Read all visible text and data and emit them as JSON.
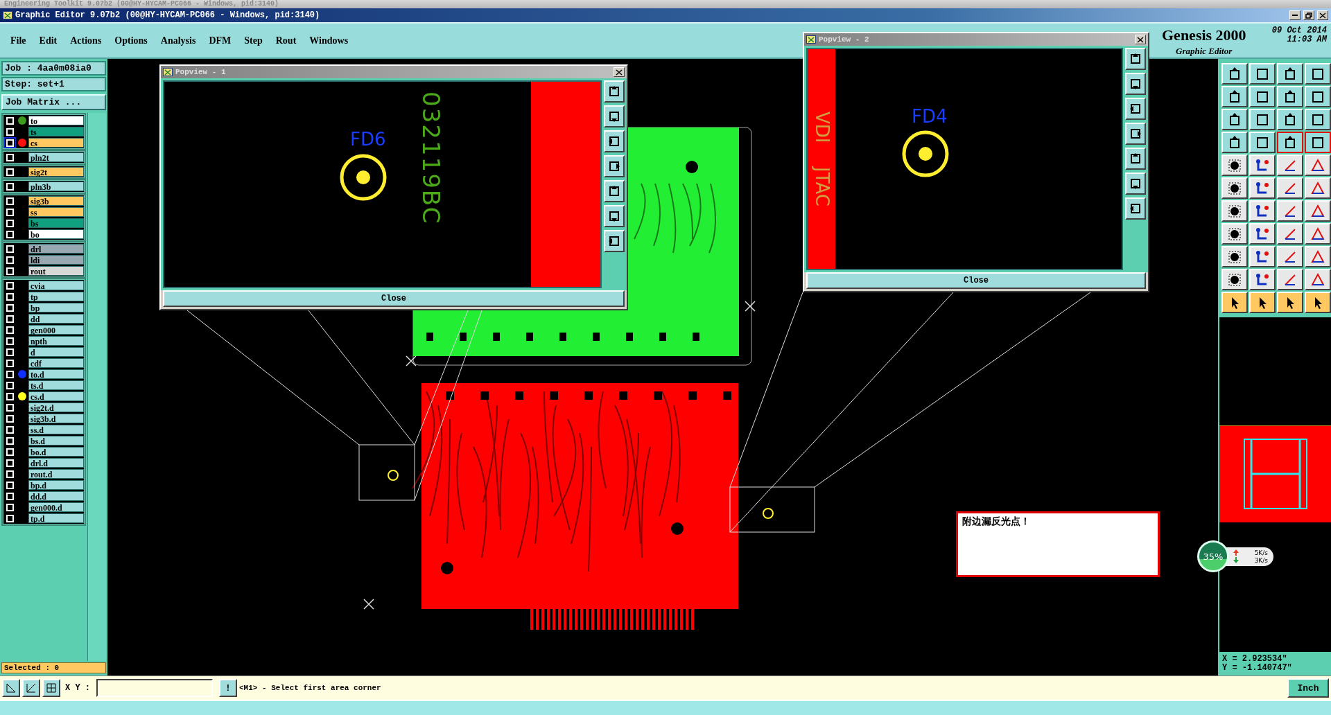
{
  "background_window": {
    "title": "Engineering Toolkit 9.07b2 (00@HY-HYCAM-PC066 - Windows, pid:3140)"
  },
  "window": {
    "title": "Graphic Editor 9.07b2 (00@HY-HYCAM-PC066 - Windows, pid:3140)"
  },
  "menu": [
    "File",
    "Edit",
    "Actions",
    "Options",
    "Analysis",
    "DFM",
    "Step",
    "Rout",
    "Windows"
  ],
  "brand": {
    "name": "Genesis 2000",
    "subtitle": "Graphic Editor",
    "date": "09 Oct 2014",
    "time": "11:03 AM"
  },
  "job": "Job : 4aa0m08ia0",
  "step": "Step: set+1",
  "job_matrix_button": "Job Matrix ...",
  "layer_groups": [
    {
      "layers": [
        {
          "name": "to",
          "color": "#ffffff",
          "marker": {
            "color": "#3c9a1e"
          },
          "selected": false
        },
        {
          "name": "ts",
          "color": "#10a080",
          "selected": false
        },
        {
          "name": "cs",
          "color": "#ffc860",
          "marker": {
            "color": "#ff1010"
          },
          "selected": true
        }
      ]
    },
    {
      "layers": [
        {
          "name": "pln2t",
          "color": "#a0dcdc",
          "selected": false
        }
      ]
    },
    {
      "layers": [
        {
          "name": "sig2t",
          "color": "#ffc860",
          "selected": false
        }
      ]
    },
    {
      "layers": [
        {
          "name": "pln3b",
          "color": "#a0dcdc",
          "selected": false
        }
      ]
    },
    {
      "layers": [
        {
          "name": "sig3b",
          "color": "#ffc860",
          "selected": false
        },
        {
          "name": "ss",
          "color": "#ffc860",
          "selected": false
        },
        {
          "name": "bs",
          "color": "#10a080",
          "selected": false
        },
        {
          "name": "bo",
          "color": "#ffffff",
          "selected": false
        }
      ]
    },
    {
      "layers": [
        {
          "name": "drl",
          "color": "#98a8b0",
          "selected": false
        },
        {
          "name": "ldi",
          "color": "#98a8b0",
          "selected": false
        },
        {
          "name": "rout",
          "color": "#d8d8d8",
          "selected": false
        }
      ]
    },
    {
      "layers": [
        {
          "name": "cvia",
          "color": "#a0dcdc",
          "selected": false
        },
        {
          "name": "tp",
          "color": "#a0dcdc",
          "selected": false
        },
        {
          "name": "bp",
          "color": "#a0dcdc",
          "selected": false
        },
        {
          "name": "dd",
          "color": "#a0dcdc",
          "selected": false
        },
        {
          "name": "gen000",
          "color": "#a0dcdc",
          "selected": false
        },
        {
          "name": "npth",
          "color": "#a0dcdc",
          "selected": false
        },
        {
          "name": "d",
          "color": "#a0dcdc",
          "selected": false
        },
        {
          "name": "cdf",
          "color": "#a0dcdc",
          "selected": false
        },
        {
          "name": "to.d",
          "color": "#a0dcdc",
          "marker": {
            "color": "#1030ff"
          },
          "selected": false
        },
        {
          "name": "ts.d",
          "color": "#a0dcdc",
          "selected": false
        },
        {
          "name": "cs.d",
          "color": "#a0dcdc",
          "marker": {
            "color": "#ffff20"
          },
          "selected": false
        },
        {
          "name": "sig2t.d",
          "color": "#a0dcdc",
          "selected": false
        },
        {
          "name": "sig3b.d",
          "color": "#a0dcdc",
          "selected": false
        },
        {
          "name": "ss.d",
          "color": "#a0dcdc",
          "selected": false
        },
        {
          "name": "bs.d",
          "color": "#a0dcdc",
          "selected": false
        },
        {
          "name": "bo.d",
          "color": "#a0dcdc",
          "selected": false
        },
        {
          "name": "drl.d",
          "color": "#a0dcdc",
          "selected": false
        },
        {
          "name": "rout.d",
          "color": "#a0dcdc",
          "selected": false
        },
        {
          "name": "bp.d",
          "color": "#a0dcdc",
          "selected": false
        },
        {
          "name": "dd.d",
          "color": "#a0dcdc",
          "selected": false
        },
        {
          "name": "gen000.d",
          "color": "#a0dcdc",
          "selected": false
        },
        {
          "name": "tp.d",
          "color": "#a0dcdc",
          "selected": false
        }
      ]
    }
  ],
  "selected_count": "Selected : 0",
  "popviews": [
    {
      "title": "Popview - 1",
      "label": "FD6",
      "board_text": "032119BC",
      "close": "Close"
    },
    {
      "title": "Popview - 2",
      "label": "FD4",
      "side_texts": [
        "VDI",
        "JTAC"
      ],
      "close": "Close"
    }
  ],
  "alert": "附边漏反光点！",
  "network": {
    "percent": "35%",
    "up": "5K/s",
    "down": "3K/s"
  },
  "tools": [
    {
      "kind": "teal"
    },
    {
      "kind": "teal"
    },
    {
      "kind": "teal"
    },
    {
      "kind": "teal"
    },
    {
      "kind": "teal"
    },
    {
      "kind": "teal"
    },
    {
      "kind": "teal"
    },
    {
      "kind": "teal"
    },
    {
      "kind": "teal"
    },
    {
      "kind": "teal"
    },
    {
      "kind": "teal"
    },
    {
      "kind": "teal"
    },
    {
      "kind": "teal"
    },
    {
      "kind": "teal"
    },
    {
      "kind": "alert"
    },
    {
      "kind": "alert"
    },
    {
      "kind": "plain"
    },
    {
      "kind": "plain"
    },
    {
      "kind": "plain"
    },
    {
      "kind": "plain"
    },
    {
      "kind": "plain"
    },
    {
      "kind": "plain"
    },
    {
      "kind": "plain"
    },
    {
      "kind": "plain"
    },
    {
      "kind": "plain"
    },
    {
      "kind": "plain"
    },
    {
      "kind": "plain"
    },
    {
      "kind": "plain"
    },
    {
      "kind": "plain"
    },
    {
      "kind": "plain"
    },
    {
      "kind": "plain"
    },
    {
      "kind": "plain"
    },
    {
      "kind": "plain"
    },
    {
      "kind": "plain"
    },
    {
      "kind": "plain"
    },
    {
      "kind": "plain"
    },
    {
      "kind": "plain"
    },
    {
      "kind": "plain"
    },
    {
      "kind": "plain"
    },
    {
      "kind": "plain"
    },
    {
      "kind": "orange"
    },
    {
      "kind": "orange"
    },
    {
      "kind": "orange"
    },
    {
      "kind": "orange"
    }
  ],
  "cursor": {
    "x": "X = 2.923534\"",
    "y": "Y = -1.140747\""
  },
  "bottom": {
    "xy_label": "X Y :",
    "prompt_button": "!",
    "prompt": "<M1> - Select first area corner",
    "units_button": "Inch"
  }
}
